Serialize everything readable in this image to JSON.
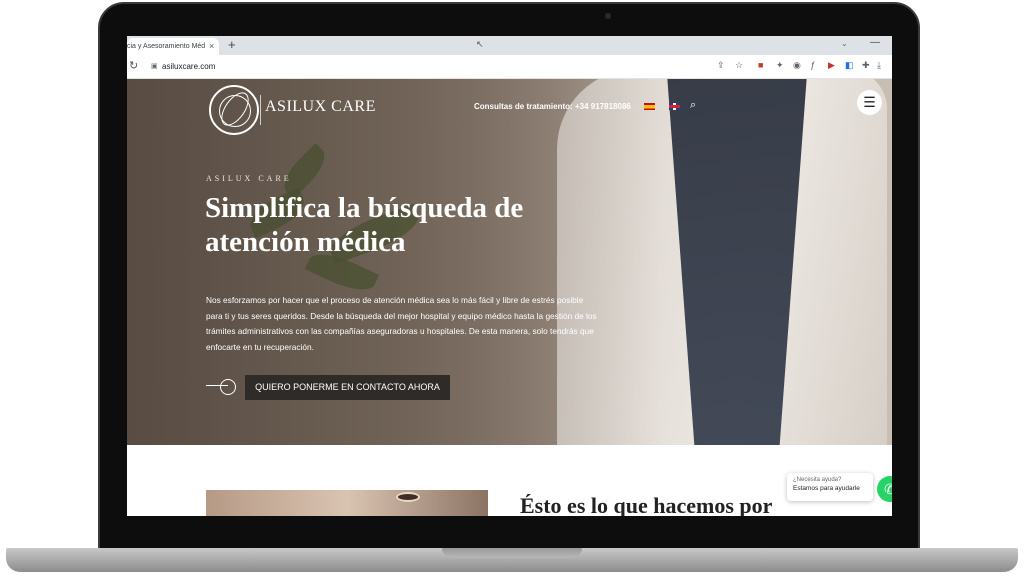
{
  "browser": {
    "tab_title": "cia y Asesoramiento Méd",
    "tab_close": "×",
    "new_tab": "+",
    "url": "asiluxcare.com"
  },
  "site": {
    "logo_text": "ASILUX CARE",
    "nav": {
      "consult_label": "Consultas de tratamiento:",
      "phone": "+34 917818086"
    },
    "hero": {
      "eyebrow": "ASILUX CARE",
      "headline": "Simplifica la búsqueda de atención médica",
      "lead": "Nos esforzamos por hacer que el proceso de atención médica sea lo más fácil y libre de estrés posible para ti y tus seres queridos. Desde la búsqueda del mejor hospital y equipo médico hasta la gestión de los trámites administrativos con las compañías aseguradoras u hospitales. De esta manera, solo tendrás que enfocarte en tu recuperación.",
      "cta_label": "QUIERO PONERME EN CONTACTO AHORA"
    },
    "section": {
      "title": "Ésto es lo que hacemos por"
    },
    "help_widget": {
      "line1": "¿Necesita ayuda?",
      "line2": "Estamos para ayudarle"
    }
  },
  "icons": {
    "reload": "↻",
    "lock": "🔒",
    "search": "⌕",
    "menu": "☰",
    "whatsapp": "✆",
    "chevron": "⌄",
    "minimize": "—"
  },
  "colors": {
    "cta_bg": "#2f2b29",
    "whatsapp": "#25d366"
  }
}
